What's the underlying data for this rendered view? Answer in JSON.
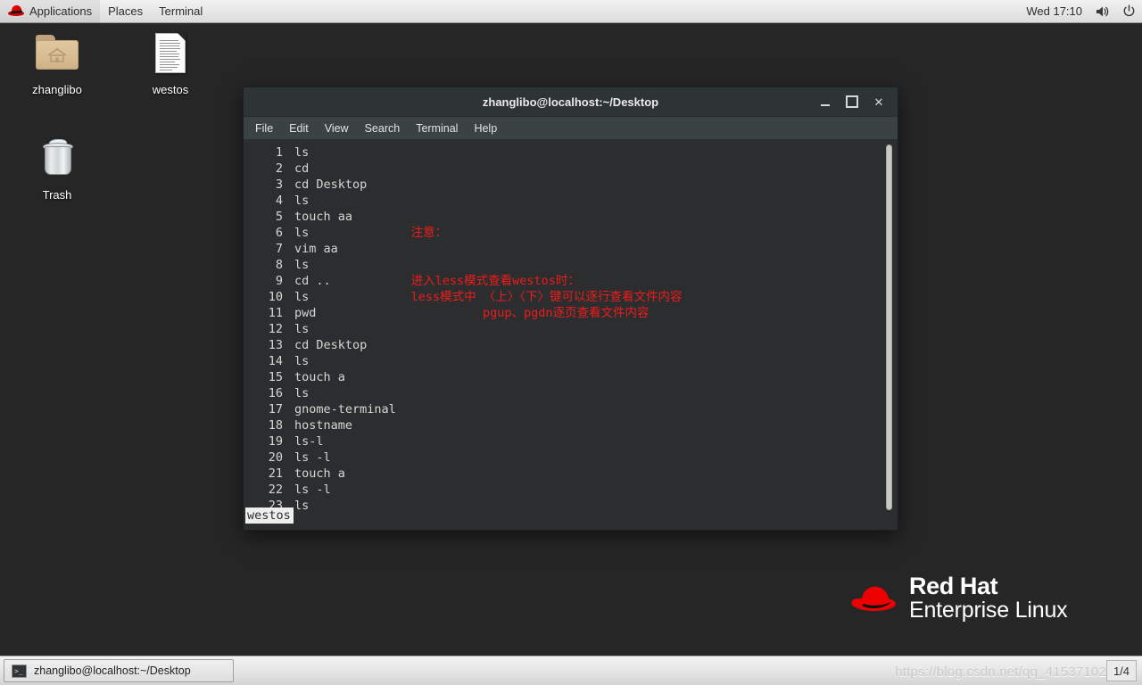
{
  "top_panel": {
    "applications_label": "Applications",
    "places_label": "Places",
    "terminal_label": "Terminal",
    "clock": "Wed 17:10",
    "icons": {
      "logo": "red-hat-fedora-icon",
      "volume": "volume-icon",
      "power": "power-icon"
    }
  },
  "desktop": {
    "background_color": "#262626",
    "icons": [
      {
        "label": "zhanglibo",
        "type": "home-folder"
      },
      {
        "label": "westos",
        "type": "text-document"
      },
      {
        "label": "Trash",
        "type": "trash-can"
      }
    ]
  },
  "terminal": {
    "title": "zhanglibo@localhost:~/Desktop",
    "menu": [
      "File",
      "Edit",
      "View",
      "Search",
      "Terminal",
      "Help"
    ],
    "window_buttons": {
      "minimize": "_",
      "maximize": "□",
      "close": "✕"
    },
    "colors": {
      "background": "#2b2d2e",
      "foreground": "#d6d6d6",
      "annotation": "#ee1c1c"
    },
    "history": [
      {
        "num": "1",
        "cmd": "ls"
      },
      {
        "num": "2",
        "cmd": "cd"
      },
      {
        "num": "3",
        "cmd": "cd Desktop"
      },
      {
        "num": "4",
        "cmd": "ls"
      },
      {
        "num": "5",
        "cmd": "touch aa"
      },
      {
        "num": "6",
        "cmd": "ls"
      },
      {
        "num": "7",
        "cmd": "vim aa"
      },
      {
        "num": "8",
        "cmd": "ls"
      },
      {
        "num": "9",
        "cmd": "cd .."
      },
      {
        "num": "10",
        "cmd": "ls"
      },
      {
        "num": "11",
        "cmd": "pwd"
      },
      {
        "num": "12",
        "cmd": "ls"
      },
      {
        "num": "13",
        "cmd": "cd Desktop"
      },
      {
        "num": "14",
        "cmd": "ls"
      },
      {
        "num": "15",
        "cmd": "touch a"
      },
      {
        "num": "16",
        "cmd": "ls"
      },
      {
        "num": "17",
        "cmd": "gnome-terminal"
      },
      {
        "num": "18",
        "cmd": "hostname"
      },
      {
        "num": "19",
        "cmd": "ls-l"
      },
      {
        "num": "20",
        "cmd": "ls -l"
      },
      {
        "num": "21",
        "cmd": "touch a"
      },
      {
        "num": "22",
        "cmd": "ls -l"
      },
      {
        "num": "23",
        "cmd": "ls"
      }
    ],
    "annotations": [
      {
        "text": "注意：",
        "line": 5,
        "indent": 28
      },
      {
        "text": "进入less模式查看westos时：",
        "line": 8,
        "indent": 28
      },
      {
        "text": "less模式中 〈上〉〈下〉键可以逐行查看文件内容",
        "line": 9,
        "indent": 28
      },
      {
        "text": "pgup、pgdn逐页查看文件内容",
        "line": 10,
        "indent": 40
      }
    ],
    "prompt_output": "westos"
  },
  "rhel_logo": {
    "line1": "Red Hat",
    "line2": "Enterprise Linux",
    "hat_color": "#ee0000"
  },
  "taskbar": {
    "task_label": "zhanglibo@localhost:~/Desktop",
    "watermark": "https://blog.csdn.net/qq_41537102",
    "workspace": "1/4"
  }
}
